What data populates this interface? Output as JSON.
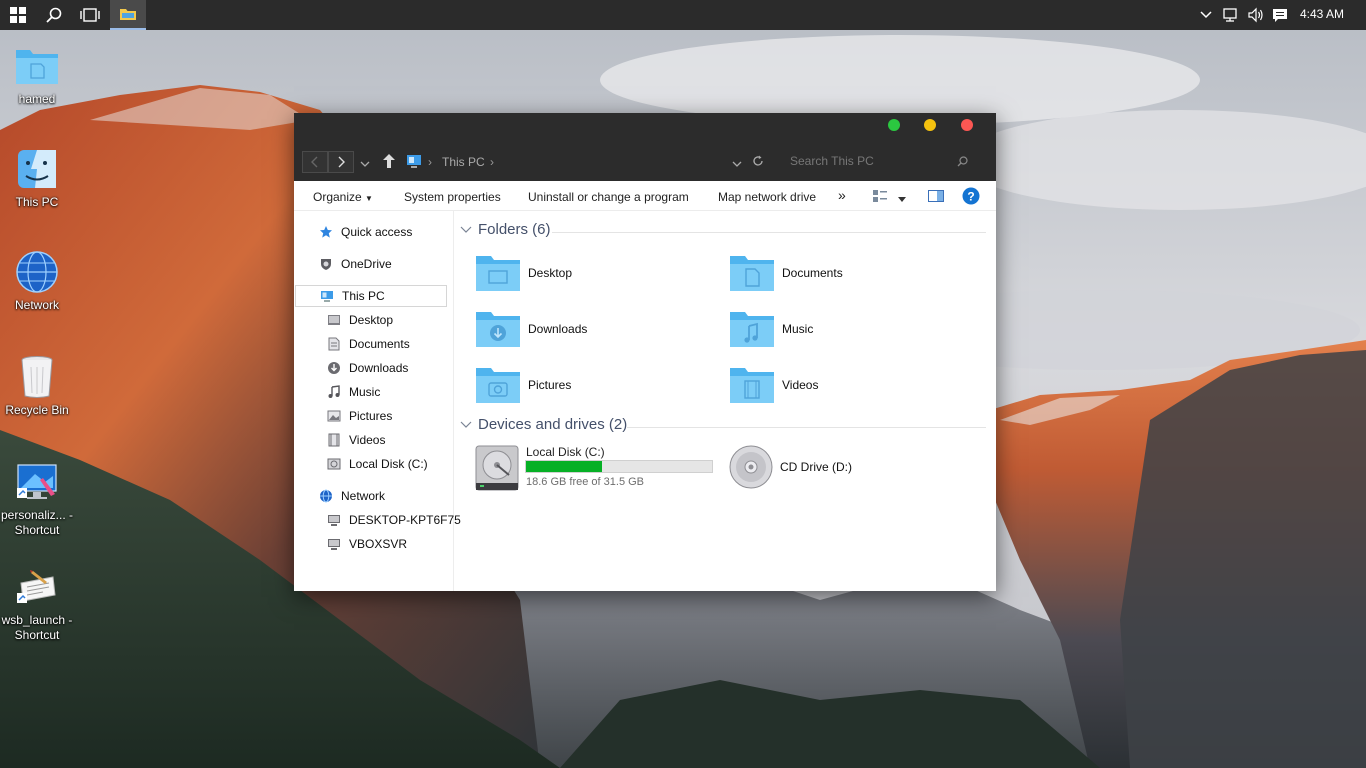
{
  "taskbar": {
    "clock": "4:43 AM"
  },
  "desktop_icons": [
    {
      "label": "hamed"
    },
    {
      "label": "This PC"
    },
    {
      "label": "Network"
    },
    {
      "label": "Recycle Bin"
    },
    {
      "label": "personaliz... - Shortcut"
    },
    {
      "label": "wsb_launch - Shortcut"
    }
  ],
  "explorer": {
    "breadcrumb": "This PC",
    "search_placeholder": "Search This PC",
    "commands": {
      "organize": "Organize",
      "system_properties": "System properties",
      "uninstall": "Uninstall or change a program",
      "map_drive": "Map network drive",
      "more": "»"
    },
    "nav": {
      "quick_access": "Quick access",
      "onedrive": "OneDrive",
      "this_pc": "This PC",
      "desktop": "Desktop",
      "documents": "Documents",
      "downloads": "Downloads",
      "music": "Music",
      "pictures": "Pictures",
      "videos": "Videos",
      "local_disk": "Local Disk (C:)",
      "network": "Network",
      "desktop_kpt": "DESKTOP-KPT6F75",
      "vboxsvr": "VBOXSVR"
    },
    "folders_header": "Folders (6)",
    "folders": {
      "desktop": "Desktop",
      "documents": "Documents",
      "downloads": "Downloads",
      "music": "Music",
      "pictures": "Pictures",
      "videos": "Videos"
    },
    "devices_header": "Devices and drives (2)",
    "drives": {
      "c_label": "Local Disk (C:)",
      "c_free": "18.6 GB free of 31.5 GB",
      "c_used_fraction": 0.41,
      "d_label": "CD Drive (D:)"
    }
  },
  "colors": {
    "taskbar": "#2b2b2b",
    "folder_blue": "#62c3f5",
    "drive_fill": "#06b025",
    "traffic_green": "#2bc840",
    "traffic_yellow": "#f5c20f",
    "traffic_red": "#fc5753"
  }
}
